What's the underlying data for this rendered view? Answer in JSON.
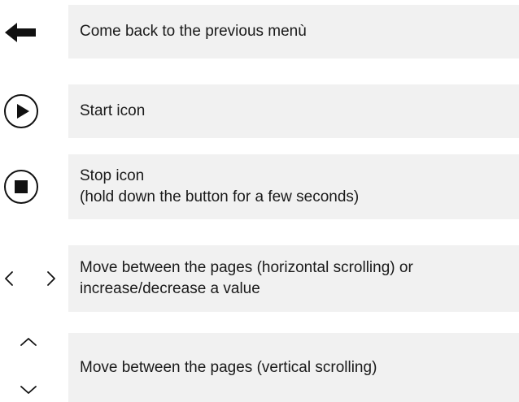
{
  "rows": [
    {
      "icon": "back-arrow-icon",
      "lines": [
        "Come back to the previous menù"
      ]
    },
    {
      "icon": "play-circle-icon",
      "lines": [
        "Start icon"
      ]
    },
    {
      "icon": "stop-circle-icon",
      "lines": [
        "Stop icon",
        "(hold down the button for a few seconds)"
      ]
    },
    {
      "icon": "chevron-left-right-icon",
      "lines": [
        "Move between the pages (horizontal scrolling) or",
        "increase/decrease a value"
      ]
    },
    {
      "icon": "chevron-up-down-icon",
      "lines": [
        "Move between the pages (vertical scrolling)"
      ]
    }
  ],
  "colors": {
    "row_background": "#f1f1f1",
    "icon": "#111111",
    "text": "#1a1a1a"
  }
}
